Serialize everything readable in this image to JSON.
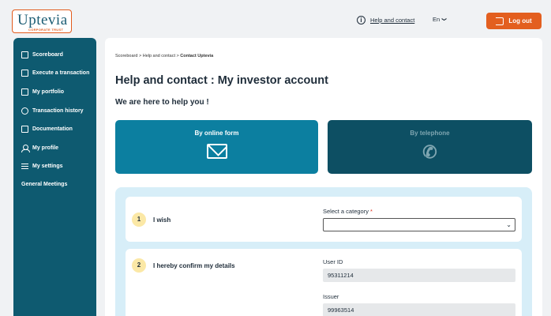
{
  "header": {
    "logo_text": "Uptevia",
    "logo_sub": "CORPORATE TRUST",
    "help_link": "Help and contact",
    "language": "En",
    "language_caret": "❯",
    "logout_label": "Log out"
  },
  "sidebar": {
    "items": [
      {
        "label": "Scoreboard",
        "icon": "dashboard-icon"
      },
      {
        "label": "Execute a transaction",
        "icon": "transaction-icon"
      },
      {
        "label": "My portfolio",
        "icon": "portfolio-icon"
      },
      {
        "label": "Transaction history",
        "icon": "history-icon"
      },
      {
        "label": "Documentation",
        "icon": "document-icon"
      },
      {
        "label": "My profile",
        "icon": "profile-icon"
      },
      {
        "label": "My settings",
        "icon": "settings-icon"
      },
      {
        "label": "General Meetings",
        "icon": ""
      }
    ]
  },
  "main": {
    "breadcrumb": {
      "scoreboard": "Scoreboard",
      "help": "Help and contact",
      "current": "Contact Uptevia",
      "separator": ">"
    },
    "title": "Help and contact :  My investor account",
    "subtitle": "We are here to help you  !",
    "tabs": {
      "form_label": "By online form",
      "phone_label": "By telephone"
    },
    "step1": {
      "number": "1",
      "label": "I wish",
      "category_label": "Select a category",
      "required_mark": "*",
      "category_value": ""
    },
    "step2": {
      "number": "2",
      "label": "I hereby confirm my details",
      "user_id_label": "User ID",
      "user_id_value": "95311214",
      "issuer_label": "Issuer",
      "issuer_value": "99963514"
    }
  },
  "colors": {
    "sidebar_bg": "#0e5a70",
    "tab_form_bg": "#0c7fa0",
    "tab_phone_bg": "#0d4f63",
    "accent": "#e35f1f",
    "form_bg": "#d7eef8"
  }
}
